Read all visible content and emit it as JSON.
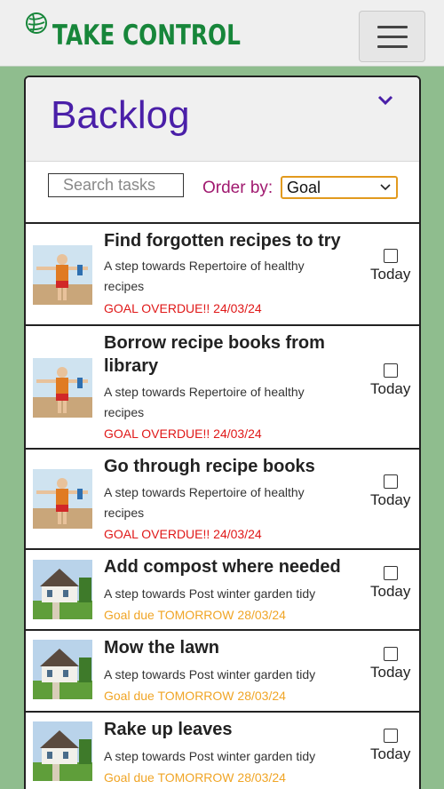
{
  "app": {
    "logo_text": "TAKE CONTROL"
  },
  "panel": {
    "title": "Backlog"
  },
  "filters": {
    "search_placeholder": "Search tasks",
    "order_label": "Order by:",
    "order_value": "Goal"
  },
  "colors": {
    "brand": "#17863a",
    "title": "#4a1fa8",
    "overdue": "#e01818",
    "tomorrow": "#f0a526",
    "accent": "#e29a1e",
    "background": "#8fbd8e"
  },
  "tasks": [
    {
      "title": "Find forgotten recipes to try",
      "subtitle": "A step towards Repertoire of healthy recipes",
      "due": "GOAL OVERDUE!! 24/03/24",
      "due_status": "overdue",
      "today_label": "Today",
      "image": "woman-stretching"
    },
    {
      "title": "Borrow recipe books from library",
      "subtitle": "A step towards Repertoire of healthy recipes",
      "due": "GOAL OVERDUE!! 24/03/24",
      "due_status": "overdue",
      "today_label": "Today",
      "image": "woman-stretching"
    },
    {
      "title": "Go through recipe books",
      "subtitle": "A step towards Repertoire of healthy recipes",
      "due": "GOAL OVERDUE!! 24/03/24",
      "due_status": "overdue",
      "today_label": "Today",
      "image": "woman-stretching"
    },
    {
      "title": "Add compost where needed",
      "subtitle": "A step towards Post winter garden tidy",
      "due": "Goal due TOMORROW 28/03/24",
      "due_status": "tomorrow",
      "today_label": "Today",
      "image": "house-garden"
    },
    {
      "title": "Mow the lawn",
      "subtitle": "A step towards Post winter garden tidy",
      "due": "Goal due TOMORROW 28/03/24",
      "due_status": "tomorrow",
      "today_label": "Today",
      "image": "house-garden"
    },
    {
      "title": "Rake up leaves",
      "subtitle": "A step towards Post winter garden tidy",
      "due": "Goal due TOMORROW 28/03/24",
      "due_status": "tomorrow",
      "today_label": "Today",
      "image": "house-garden"
    }
  ]
}
